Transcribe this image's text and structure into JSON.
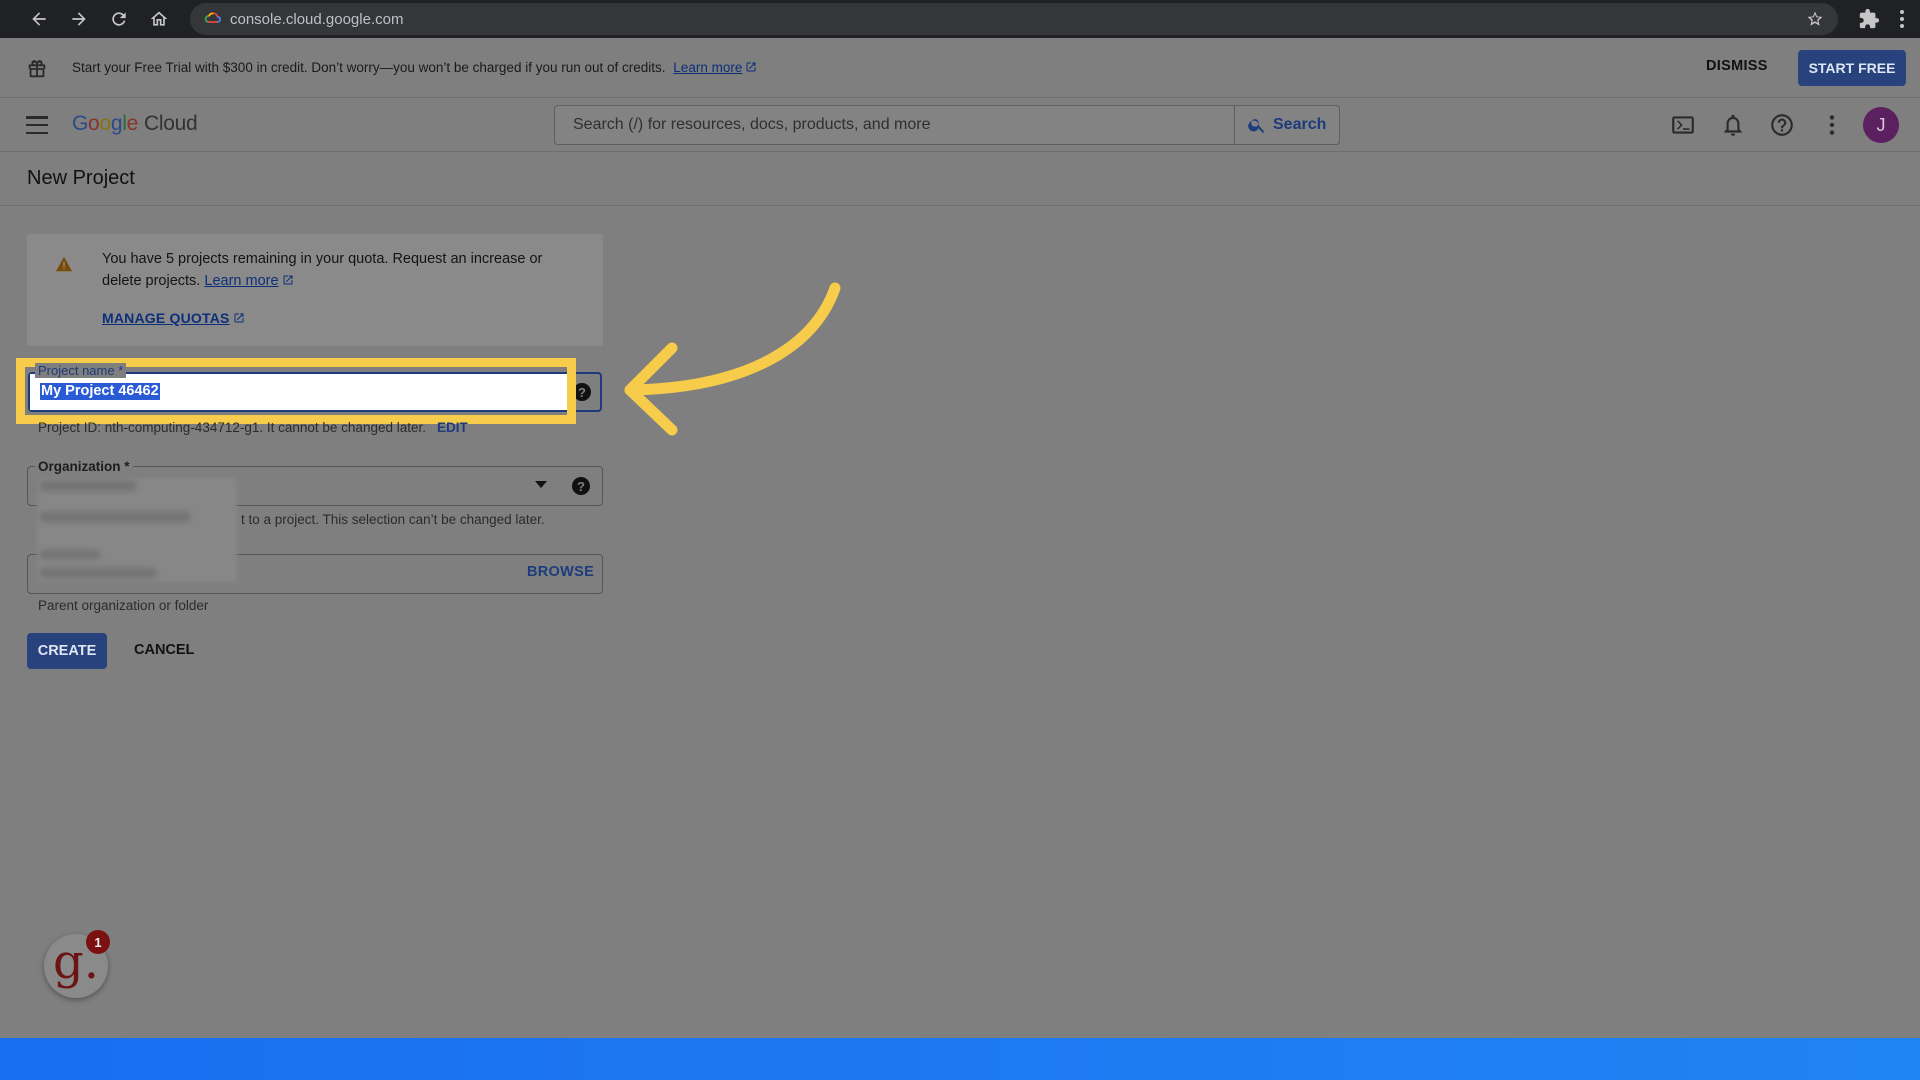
{
  "browser": {
    "url": "console.cloud.google.com"
  },
  "banner": {
    "text": "Start your Free Trial with $300 in credit. Don’t worry—you won’t be charged if you run out of credits.",
    "link_label": "Learn more",
    "dismiss_label": "DISMISS",
    "start_label": "START FREE"
  },
  "header": {
    "logo_letters": [
      "G",
      "o",
      "o",
      "g",
      "l",
      "e"
    ],
    "logo_suffix": "Cloud",
    "search_placeholder": "Search (/) for resources, docs, products, and more",
    "search_button_label": "Search",
    "avatar_initial": "J"
  },
  "page": {
    "title": "New Project"
  },
  "quota": {
    "text": "You have 5 projects remaining in your quota. Request an increase or delete projects.",
    "learn_more": "Learn more",
    "manage_label": "MANAGE QUOTAS"
  },
  "form": {
    "project_name_label": "Project name *",
    "project_name_value": "My Project 46462",
    "project_id_text": "Project ID: nth-computing-434712-g1. It cannot be changed later.",
    "edit_label": "EDIT",
    "organization_label": "Organization *",
    "organization_hint": "t to a project. This selection can’t be changed later.",
    "browse_label": "BROWSE",
    "location_hint": "Parent organization or folder",
    "create_label": "CREATE",
    "cancel_label": "CANCEL"
  },
  "widget": {
    "letter": "g.",
    "badge_count": "1"
  },
  "colors": {
    "highlight": "#f6cc4a",
    "primary": "#27427d",
    "selection": "#2a5bd7"
  }
}
